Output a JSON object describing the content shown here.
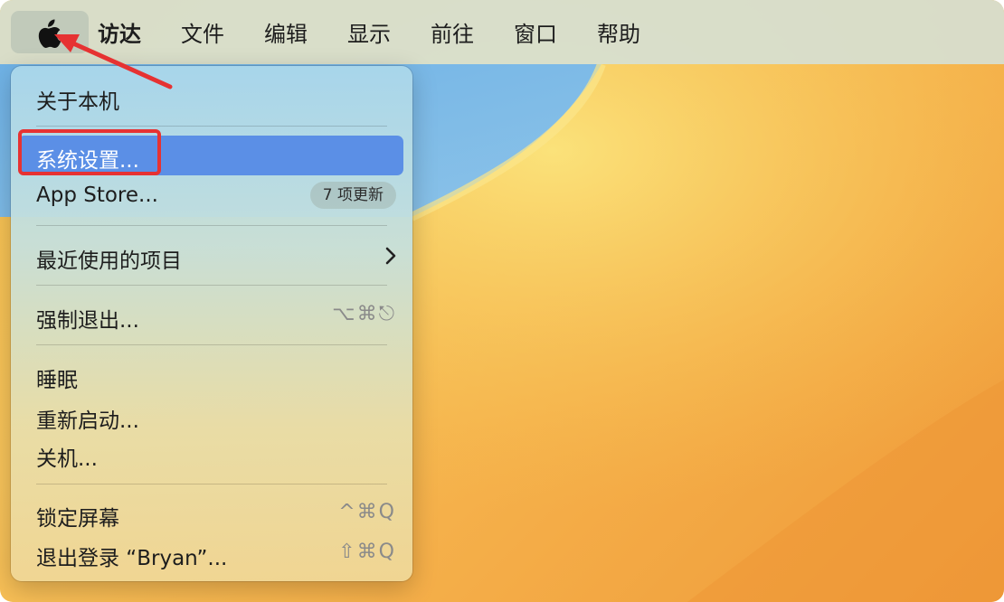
{
  "menubar": {
    "apple_icon": "apple-logo-icon",
    "items": [
      {
        "label": "访达",
        "bold": true
      },
      {
        "label": "文件"
      },
      {
        "label": "编辑"
      },
      {
        "label": "显示"
      },
      {
        "label": "前往"
      },
      {
        "label": "窗口"
      },
      {
        "label": "帮助"
      }
    ]
  },
  "apple_menu": {
    "about": "关于本机",
    "system_settings": "系统设置...",
    "app_store": "App Store...",
    "app_store_badge": "7 项更新",
    "recent_items": "最近使用的项目",
    "force_quit": "强制退出...",
    "force_quit_shortcut": "⌥⌘⎋",
    "sleep": "睡眠",
    "restart": "重新启动...",
    "shutdown": "关机...",
    "lock_screen": "锁定屏幕",
    "lock_screen_shortcut": "^⌘Q",
    "logout": "退出登录 “Bryan”...",
    "logout_shortcut": "⇧⌘Q"
  },
  "colors": {
    "highlight": "#5b8fe6",
    "annotation": "#e63232"
  }
}
